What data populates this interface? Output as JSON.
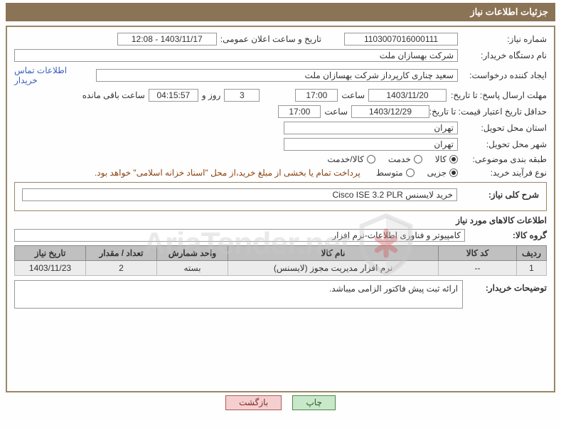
{
  "header": {
    "title": "جزئیات اطلاعات نیاز"
  },
  "need": {
    "number_label": "شماره نیاز:",
    "number": "1103007016000111",
    "announce_label": "تاریخ و ساعت اعلان عمومی:",
    "announce": "1403/11/17 - 12:08",
    "buyer_org_label": "نام دستگاه خریدار:",
    "buyer_org": "شرکت بهسازان ملت",
    "creator_label": "ایجاد کننده درخواست:",
    "creator": "سعید چناری کارپرداز شرکت بهسازان ملت",
    "contact_link": "اطلاعات تماس خریدار",
    "reply_deadline_label": "مهلت ارسال پاسخ: تا تاریخ:",
    "reply_deadline_date": "1403/11/20",
    "time_label": "ساعت",
    "reply_deadline_time": "17:00",
    "days_and_label": "روز و",
    "remaining_days": "3",
    "remaining_time": "04:15:57",
    "remaining_suffix": "ساعت باقی مانده",
    "price_valid_label": "حداقل تاریخ اعتبار قیمت: تا تاریخ:",
    "price_valid_date": "1403/12/29",
    "price_valid_time": "17:00",
    "province_label": "استان محل تحویل:",
    "province": "تهران",
    "city_label": "شهر محل تحویل:",
    "city": "تهران",
    "subject_class_label": "طبقه بندی موضوعی:",
    "subject_opts": {
      "goods": "کالا",
      "service": "خدمت",
      "goods_service": "کالا/خدمت"
    },
    "purchase_type_label": "نوع فرآیند خرید:",
    "purchase_opts": {
      "minor": "جزیی",
      "medium": "متوسط"
    },
    "payment_note": "پرداخت تمام یا بخشی از مبلغ خرید،از محل \"اسناد خزانه اسلامی\" خواهد بود."
  },
  "summary": {
    "title_label": "شرح کلی نیاز:",
    "title": "خرید لایسنس   Cisco ISE 3.2 PLR"
  },
  "goods_info": {
    "section_title": "اطلاعات کالاهای مورد نیاز",
    "group_label": "گروه کالا:",
    "group": "کامپیوتر و فناوری اطلاعات-نرم افزار"
  },
  "table": {
    "headers": {
      "row": "ردیف",
      "code": "کد کالا",
      "name": "نام کالا",
      "unit": "واحد شمارش",
      "qty": "تعداد / مقدار",
      "date": "تاریخ نیاز"
    },
    "rows": [
      {
        "row": "1",
        "code": "--",
        "name": "نرم افزار مدیریت مجوز (لایسنس)​",
        "unit": "بسته",
        "qty": "2",
        "date": "1403/11/23"
      }
    ]
  },
  "buyer_notes": {
    "label": "توضیحات خریدار:",
    "text": "ارائه ثبت پیش فاکتور الزامی میباشد."
  },
  "buttons": {
    "print": "چاپ",
    "back": "بازگشت"
  },
  "watermark": {
    "text": "AriaTender.net"
  }
}
